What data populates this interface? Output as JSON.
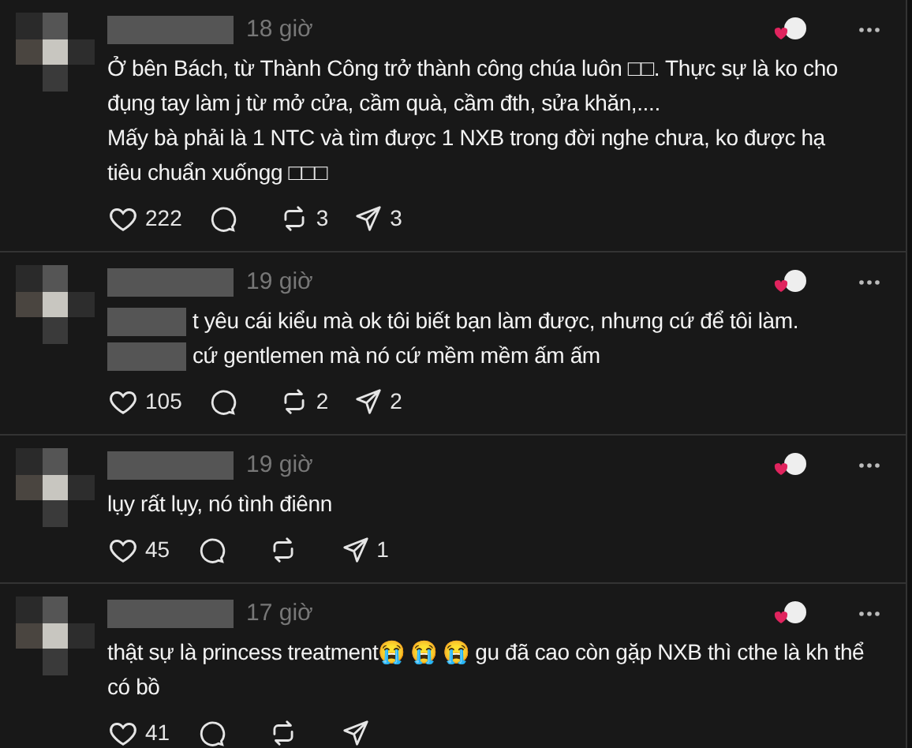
{
  "comments": [
    {
      "time": "18 giờ",
      "body": [
        {
          "kind": "text",
          "text": "Ở bên Bách, từ Thành Công trở thành công chúa luôn □□. Thực sự là ko cho đụng tay làm j từ mở cửa, cầm quà, cầm đth, sửa khăn,...."
        },
        {
          "kind": "break"
        },
        {
          "kind": "text",
          "text": "Mấy bà phải là 1 NTC và tìm được 1 NXB trong đời nghe chưa, ko được hạ tiêu chuẩn xuốngg □□□"
        }
      ],
      "likes": "222",
      "reposts": "3",
      "shares": "3"
    },
    {
      "time": "19 giờ",
      "body": [
        {
          "kind": "blur"
        },
        {
          "kind": "text",
          "text": "t yêu cái kiểu mà ok tôi biết bạn làm được, nhưng cứ để tôi làm."
        },
        {
          "kind": "blur"
        },
        {
          "kind": "text",
          "text": "cứ gentlemen mà nó cứ mềm mềm ấm ấm"
        }
      ],
      "likes": "105",
      "reposts": "2",
      "shares": "2"
    },
    {
      "time": "19 giờ",
      "body": [
        {
          "kind": "text",
          "text": "lụy rất lụy, nó tình điênn"
        }
      ],
      "likes": "45",
      "shares": "1"
    },
    {
      "time": "17 giờ",
      "body": [
        {
          "kind": "text",
          "text": "thật sự là princess treatment😭 😭 😭  gu đã cao còn gặp NXB thì cthe là kh thể có bồ"
        }
      ],
      "likes": "41"
    }
  ]
}
